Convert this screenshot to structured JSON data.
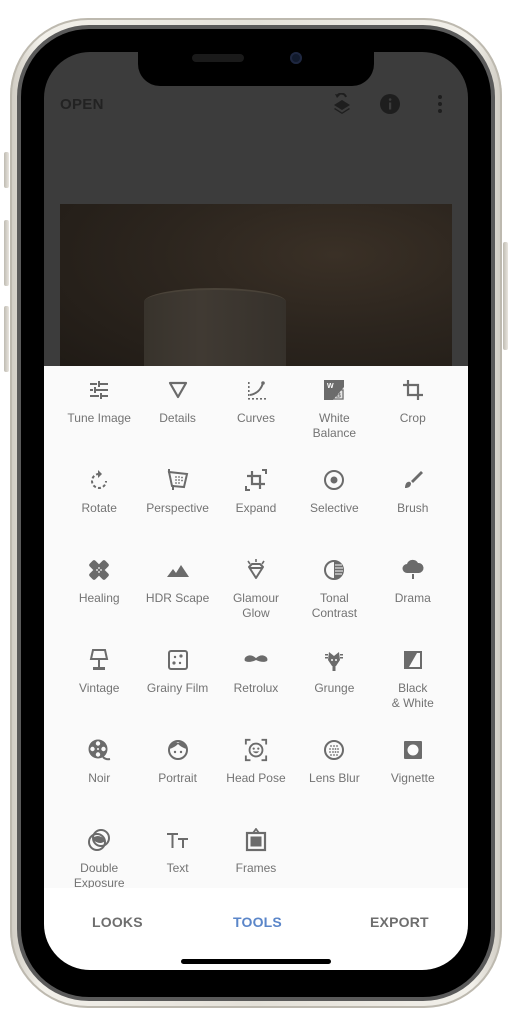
{
  "app": {
    "topbar": {
      "open_label": "OPEN",
      "icons": [
        "layers-undo-icon",
        "info-icon",
        "more-vertical-icon"
      ]
    },
    "tools": [
      {
        "label": "Tune Image",
        "icon": "sliders-icon"
      },
      {
        "label": "Details",
        "icon": "triangle-down-icon"
      },
      {
        "label": "Curves",
        "icon": "curves-icon"
      },
      {
        "label": "White\nBalance",
        "icon": "white-balance-icon"
      },
      {
        "label": "Crop",
        "icon": "crop-icon"
      },
      {
        "label": "Rotate",
        "icon": "rotate-icon"
      },
      {
        "label": "Perspective",
        "icon": "perspective-icon"
      },
      {
        "label": "Expand",
        "icon": "expand-icon"
      },
      {
        "label": "Selective",
        "icon": "selective-icon"
      },
      {
        "label": "Brush",
        "icon": "brush-icon"
      },
      {
        "label": "Healing",
        "icon": "bandage-icon"
      },
      {
        "label": "HDR Scape",
        "icon": "mountains-icon"
      },
      {
        "label": "Glamour\nGlow",
        "icon": "diamond-icon"
      },
      {
        "label": "Tonal\nContrast",
        "icon": "tonal-contrast-icon"
      },
      {
        "label": "Drama",
        "icon": "cloud-icon"
      },
      {
        "label": "Vintage",
        "icon": "lamp-icon"
      },
      {
        "label": "Grainy Film",
        "icon": "grain-icon"
      },
      {
        "label": "Retrolux",
        "icon": "mustache-icon"
      },
      {
        "label": "Grunge",
        "icon": "guitar-icon"
      },
      {
        "label": "Black\n& White",
        "icon": "black-white-icon"
      },
      {
        "label": "Noir",
        "icon": "film-reel-icon"
      },
      {
        "label": "Portrait",
        "icon": "face-icon"
      },
      {
        "label": "Head Pose",
        "icon": "face-scan-icon"
      },
      {
        "label": "Lens Blur",
        "icon": "lens-blur-icon"
      },
      {
        "label": "Vignette",
        "icon": "vignette-icon"
      },
      {
        "label": "Double\nExposure",
        "icon": "double-exposure-icon"
      },
      {
        "label": "Text",
        "icon": "text-icon"
      },
      {
        "label": "Frames",
        "icon": "frame-icon"
      }
    ],
    "bottom_nav": {
      "tabs": [
        {
          "label": "LOOKS",
          "active": false
        },
        {
          "label": "TOOLS",
          "active": true
        },
        {
          "label": "EXPORT",
          "active": false
        }
      ],
      "active_color": "#5b86c9",
      "inactive_color": "#6e6e6e"
    }
  }
}
